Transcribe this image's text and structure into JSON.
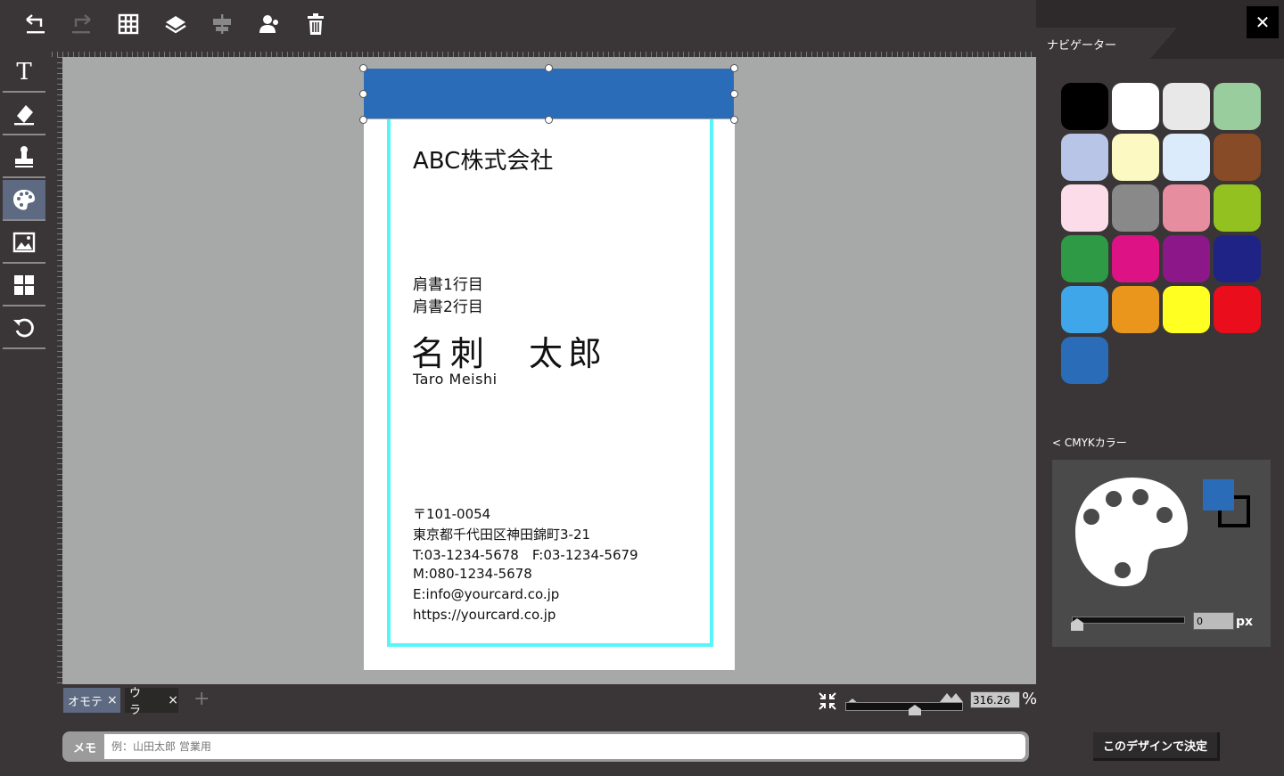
{
  "toolbar": {
    "items": [
      "undo-icon",
      "redo-icon",
      "grid-icon",
      "layers-icon",
      "align-icon",
      "person-icon",
      "trash-icon"
    ]
  },
  "left_tools": {
    "items": [
      "text-icon",
      "eraser-icon",
      "stamp-icon",
      "palette-icon",
      "image-icon",
      "layout-icon",
      "reset-icon"
    ],
    "active": "palette-icon"
  },
  "card": {
    "company": "ABC株式会社",
    "title_line1": "肩書1行目",
    "title_line2": "肩書2行目",
    "name_jp": "名刺　太郎",
    "name_en": "Taro Meishi",
    "postal": "〒101-0054",
    "address": "東京都千代田区神田錦町3-21",
    "tel_fax": "T:03-1234-5678　F:03-1234-5679",
    "mobile": "M:080-1234-5678",
    "email": "E:info@yourcard.co.jp",
    "url": "https://yourcard.co.jp",
    "accent_color": "#2b6cb8",
    "frame_color": "#55f5fa"
  },
  "pages": {
    "tabs": [
      {
        "label": "オモテ",
        "close": "×"
      },
      {
        "label": "ウラ",
        "close": "×"
      }
    ],
    "add": "+"
  },
  "zoom": {
    "value": "316.26",
    "unit": "%",
    "slider_level": 0.6
  },
  "memo": {
    "label": "メモ",
    "placeholder": "例：山田太郎 営業用"
  },
  "decide_button": "このデザインで決定",
  "navigator": {
    "title": "ナビゲーター",
    "close": "✕",
    "swatches": [
      "#000000",
      "#ffffff",
      "#e8e8e8",
      "#9acd9e",
      "#b8c5e6",
      "#fcf9c2",
      "#dcebfb",
      "#874b28",
      "#fcdce9",
      "#898989",
      "#e68da0",
      "#93c11f",
      "#2e9a45",
      "#dd1385",
      "#8c1789",
      "#1f2385",
      "#3ea6e9",
      "#ea951c",
      "#ffff21",
      "#ea0e1c",
      "#2b6cb8"
    ],
    "cmyk_link": "< CMYKカラー",
    "fill_color": "#2b6cb8",
    "stroke_value": "0",
    "stroke_unit": "px"
  }
}
